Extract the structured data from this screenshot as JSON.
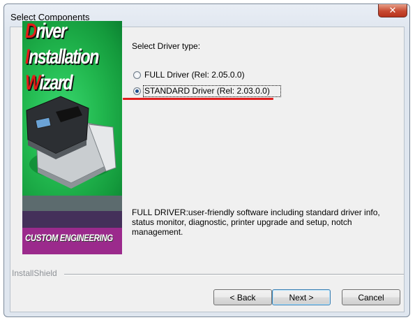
{
  "window": {
    "title": "Select Components",
    "close_glyph": "✕"
  },
  "banner": {
    "line1": {
      "cap": "D",
      "rest": "river"
    },
    "line2": {
      "cap": "I",
      "rest": "nstallation"
    },
    "line3": {
      "cap": "W",
      "rest": "izard"
    },
    "brand": "CUSTOM ENGINEERING"
  },
  "prompt": "Select Driver type:",
  "options": [
    {
      "label": "FULL Driver (Rel: 2.05.0.0)",
      "selected": false
    },
    {
      "label": "STANDARD Driver (Rel: 2.03.0.0)",
      "selected": true
    }
  ],
  "description": "FULL DRIVER:user-friendly software including standard driver info, status monitor, diagnostic, printer upgrade and setup, notch management.",
  "installshield": "InstallShield",
  "buttons": {
    "back": "< Back",
    "next": "Next >",
    "cancel": "Cancel"
  },
  "colors": {
    "highlight_underline": "#e01e1e",
    "banner_green": "#22b84f",
    "brand_purple": "#9b2a8c"
  }
}
